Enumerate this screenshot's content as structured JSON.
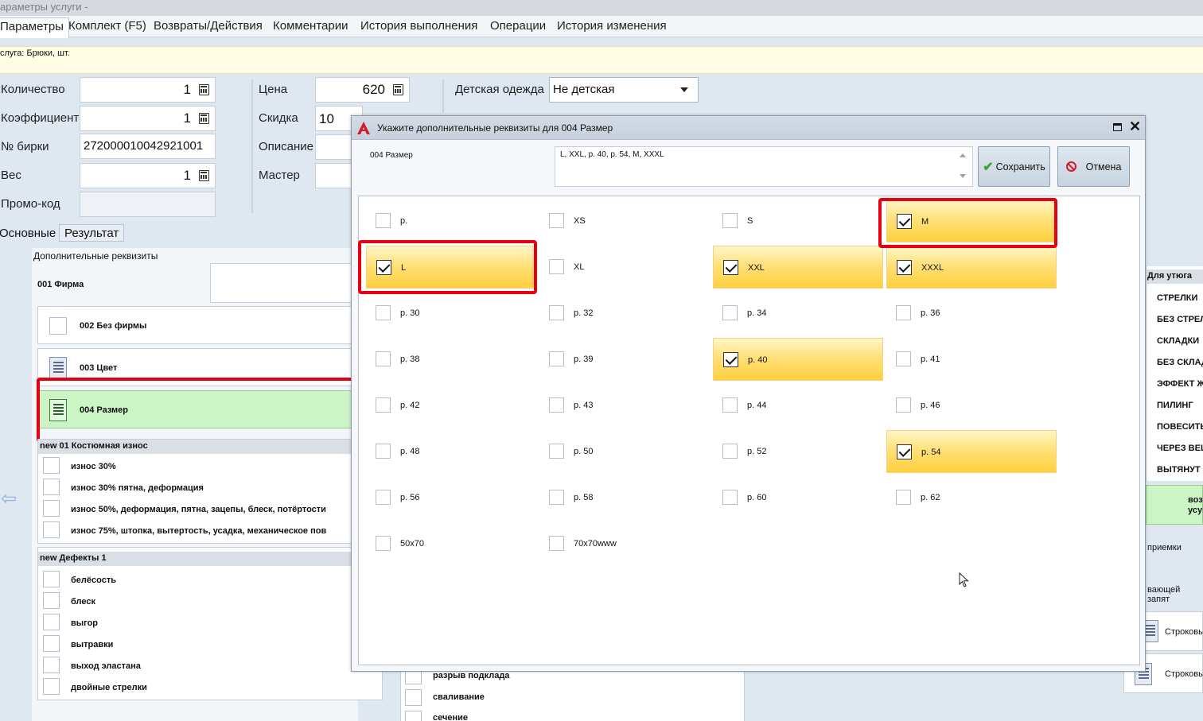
{
  "window": {
    "title": "араметры услуги -"
  },
  "tabs": [
    "Параметры",
    "Комплект (F5)",
    "Возвраты/Действия",
    "Комментарии",
    "История выполнения",
    "Операции",
    "История изменения"
  ],
  "service_info": "слуга: Брюки, шт.",
  "form": {
    "quantity_label": "Количество",
    "quantity_value": "1",
    "coef_label": "Коэффициент",
    "coef_value": "1",
    "tag_label": "№ бирки",
    "tag_value": "272000010042921001",
    "weight_label": "Вес",
    "weight_value": "1",
    "promo_label": "Промо-код",
    "promo_value": "",
    "price_label": "Цена",
    "price_value": "620",
    "discount_label": "Скидка",
    "discount_value": "10",
    "desc_label": "Описание",
    "master_label": "Мастер",
    "kids_label": "Детская одежда",
    "kids_value": "Не детская"
  },
  "subtabs": [
    "Основные",
    "Результат"
  ],
  "extra": {
    "title": "Дополнительные реквизиты",
    "rows": [
      "001 Фирма",
      "002 Без фирмы",
      "003 Цвет",
      "004 Размер"
    ]
  },
  "groups": [
    {
      "name": "new 01 Костюмная износ",
      "items": [
        "износ 30%",
        "износ 30% пятна, деформация",
        "износ 50%, деформация, пятна, зацепы, блеск, потёртости",
        "износ 75%, штопка, вытертость, усадка, механическое пов"
      ]
    },
    {
      "name": "new Дефекты 1",
      "items": [
        "белёсость",
        "блеск",
        "выгор",
        "вытравки",
        "выход эластана",
        "двойные стрелки"
      ]
    }
  ],
  "middle_items": [
    "разрыв подклада",
    "сваливание",
    "сечение"
  ],
  "right_panel": {
    "header": "Для утюга",
    "items": [
      "СТРЕЛКИ",
      "БЕЗ СТРЕЛ",
      "СКЛАДКИ",
      "БЕЗ СКЛАД",
      "ЭФФЕКТ Ж",
      "ПИЛИНГ",
      "ПОВЕСИТЬ",
      "ЧЕРЕЗ ВЕЩ",
      "ВЫТЯНУТ"
    ],
    "green_text_1": "возмож",
    "green_text_2": "усугубл",
    "text1": "приемки",
    "text2": "вающей запят",
    "rows": [
      "Строковы",
      "Строковы"
    ]
  },
  "modal": {
    "title": "Укажите дополнительные реквизиты для 004 Размер",
    "field_label": "004 Размер",
    "field_value": "L, XXL, р. 40, р. 54, M, XXXL",
    "save_label": "Сохранить",
    "cancel_label": "Отмена",
    "options": [
      {
        "label": "р.",
        "checked": false
      },
      {
        "label": "XS",
        "checked": false
      },
      {
        "label": "S",
        "checked": false
      },
      {
        "label": "M",
        "checked": true
      },
      {
        "label": "L",
        "checked": true
      },
      {
        "label": "XL",
        "checked": false
      },
      {
        "label": "XXL",
        "checked": true
      },
      {
        "label": "XXXL",
        "checked": true
      },
      {
        "label": "р. 30",
        "checked": false
      },
      {
        "label": "р. 32",
        "checked": false
      },
      {
        "label": "р. 34",
        "checked": false
      },
      {
        "label": "р. 36",
        "checked": false
      },
      {
        "label": "р. 38",
        "checked": false
      },
      {
        "label": "р. 39",
        "checked": false
      },
      {
        "label": "р. 40",
        "checked": true
      },
      {
        "label": "р. 41",
        "checked": false
      },
      {
        "label": "р. 42",
        "checked": false
      },
      {
        "label": "р. 43",
        "checked": false
      },
      {
        "label": "р. 44",
        "checked": false
      },
      {
        "label": "р. 46",
        "checked": false
      },
      {
        "label": "р. 48",
        "checked": false
      },
      {
        "label": "р. 50",
        "checked": false
      },
      {
        "label": "р. 52",
        "checked": false
      },
      {
        "label": "р. 54",
        "checked": true
      },
      {
        "label": "р. 56",
        "checked": false
      },
      {
        "label": "р. 58",
        "checked": false
      },
      {
        "label": "р. 60",
        "checked": false
      },
      {
        "label": "р. 62",
        "checked": false
      },
      {
        "label": "50x70",
        "checked": false
      },
      {
        "label": "70x70www",
        "checked": false
      }
    ]
  },
  "colors": {
    "highlight_red": "#e60012",
    "selected_green": "#ccf5c6",
    "checked_yellow": "#ffd84d"
  }
}
